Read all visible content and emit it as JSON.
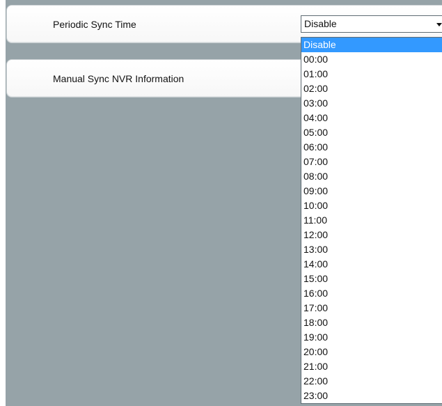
{
  "settings": {
    "periodic_sync_label": "Periodic Sync Time",
    "manual_sync_label": "Manual Sync NVR Information",
    "periodic_sync_value": "Disable"
  },
  "dropdown": {
    "selected_index": 0,
    "options": [
      "Disable",
      "00:00",
      "01:00",
      "02:00",
      "03:00",
      "04:00",
      "05:00",
      "06:00",
      "07:00",
      "08:00",
      "09:00",
      "10:00",
      "11:00",
      "12:00",
      "13:00",
      "14:00",
      "15:00",
      "16:00",
      "17:00",
      "18:00",
      "19:00",
      "20:00",
      "21:00",
      "22:00",
      "23:00"
    ]
  },
  "colors": {
    "panel_background": "#96a3a8",
    "selection_highlight": "#3399ff"
  }
}
